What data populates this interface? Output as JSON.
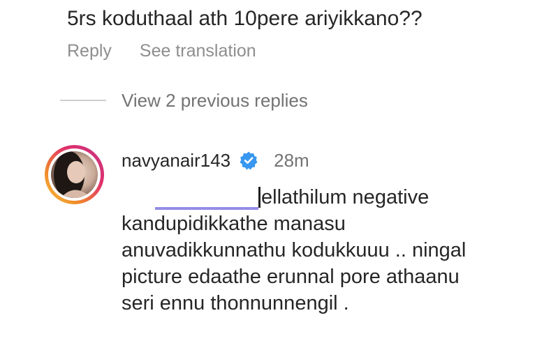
{
  "parent": {
    "comment_text": "5rs koduthaal ath 10pere ariyikkano??",
    "reply_label": "Reply",
    "translate_label": "See translation"
  },
  "thread": {
    "view_replies_label": "View 2 previous replies"
  },
  "reply": {
    "username": "navyanair143",
    "verified_icon": "verified-badge-icon",
    "timestamp": "28m",
    "lines": [
      "ellathilum negative",
      "kandupidikkathe manasu",
      "anuvadikkunnathu kodukkuuu .. ningal",
      "picture edaathe erunnal pore athaanu",
      "seri ennu thonnunnengil ."
    ]
  },
  "colors": {
    "text_primary": "#262626",
    "text_secondary": "#8e8e8e",
    "verified_blue": "#3897f0"
  }
}
